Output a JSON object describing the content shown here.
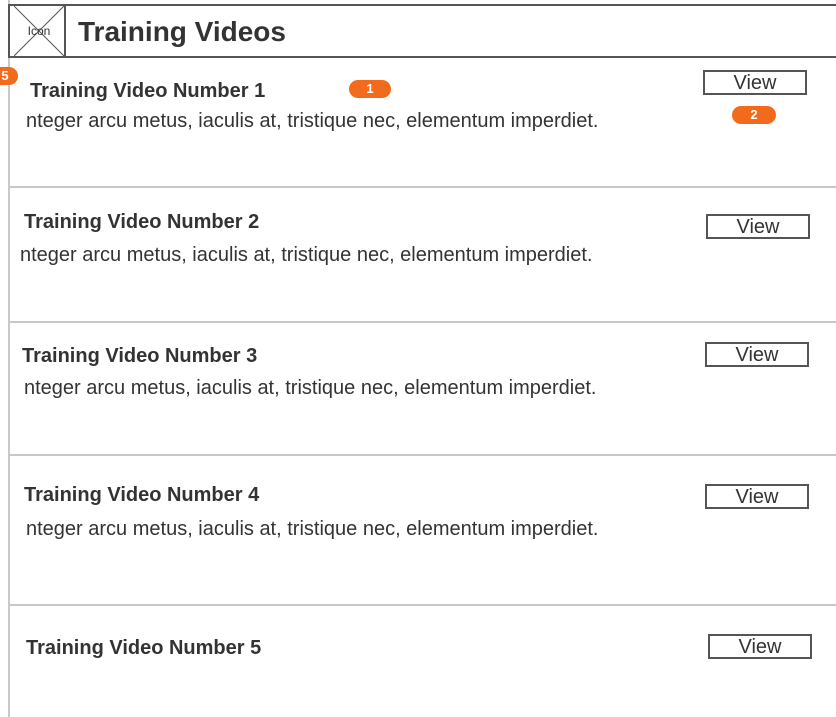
{
  "header": {
    "title": "Training Videos",
    "icon_label": "Icon",
    "icon": "image-placeholder-icon"
  },
  "badges": {
    "item_marker": "5",
    "title_marker": "1",
    "view_marker": "2"
  },
  "items": [
    {
      "title": "Training Video Number 1",
      "description": "nteger arcu metus, iaculis at, tristique nec, elementum imperdiet.",
      "button": "View"
    },
    {
      "title": "Training Video Number 2",
      "description": "nteger arcu metus, iaculis at, tristique nec, elementum imperdiet.",
      "button": "View"
    },
    {
      "title": "Training Video Number 3",
      "description": "nteger arcu metus, iaculis at, tristique nec, elementum imperdiet.",
      "button": "View"
    },
    {
      "title": "Training Video Number 4",
      "description": "nteger arcu metus, iaculis at, tristique nec, elementum imperdiet.",
      "button": "View"
    },
    {
      "title": "Training Video Number 5",
      "button": "View"
    }
  ],
  "colors": {
    "badge": "#f26b1d",
    "border": "#555555",
    "separator": "#c8c8c8",
    "text": "#333333"
  }
}
